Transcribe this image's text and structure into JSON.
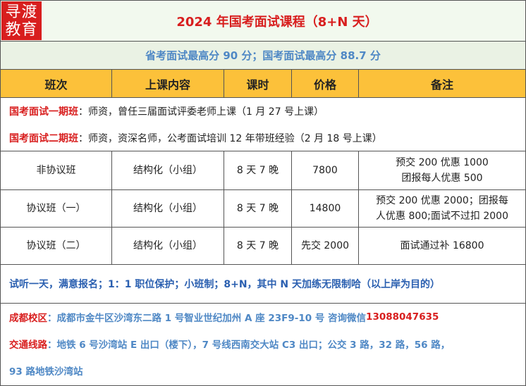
{
  "logo": {
    "line1": "寻渡",
    "line2": "教育"
  },
  "title": "2024 年国考面试课程（8+N 天）",
  "subtitle": "省考面试最高分 90 分；国考面试最高分 88.7 分",
  "headers": [
    "班次",
    "上课内容",
    "课时",
    "价格",
    "备注"
  ],
  "classes": [
    {
      "name": "国考面试一期班",
      "desc": "：师资，曾任三届面试评委老师上课（1 月 27 号上课）"
    },
    {
      "name": "国考面试二期班",
      "desc": "：师资，资深名师，公考面试培训 12 年带班经验（2 月 18 号上课）"
    }
  ],
  "rows": [
    {
      "cls": "非协议班",
      "content": "结构化（小组）",
      "hours": "8 天 7 晚",
      "price": "7800",
      "note": [
        "预交 200 优惠 1000",
        "团报每人优惠 500"
      ]
    },
    {
      "cls": "协议班（一）",
      "content": "结构化（小组）",
      "hours": "8 天 7 晚",
      "price": "14800",
      "note": [
        "预交 200 优惠 2000；团报每",
        "人优惠 800;面试不过扣 2000"
      ]
    },
    {
      "cls": "协议班（二）",
      "content": "结构化（小组）",
      "hours": "8 天 7 晚",
      "price": "先交 2000",
      "note": [
        "面试通过补 16800"
      ]
    }
  ],
  "promo": "试听一天，满意报名；1：1 职位保护；小班制；8+N，其中 N 天加练无限制哈（以上岸为目的）",
  "campus": {
    "label": "成都校区",
    "address": "：成都市金牛区沙湾东二路 1 号智业世纪加州 A 座 23F9-10 号 咨询微信 ",
    "wechat": "13088047635"
  },
  "transport": {
    "label": "交通线路",
    "line1": "：地铁 6 号沙湾站 E 出口（楼下），7 号线西南交大站 C3 出口；公交 3 路，32 路，56 路，",
    "line2": "93 路地铁沙湾站"
  },
  "colors": {
    "accent_red": "#d81e1e",
    "header_orange": "#fcc13a",
    "subtitle_blue": "#4f88c5",
    "promo_blue": "#2a5fb0"
  }
}
